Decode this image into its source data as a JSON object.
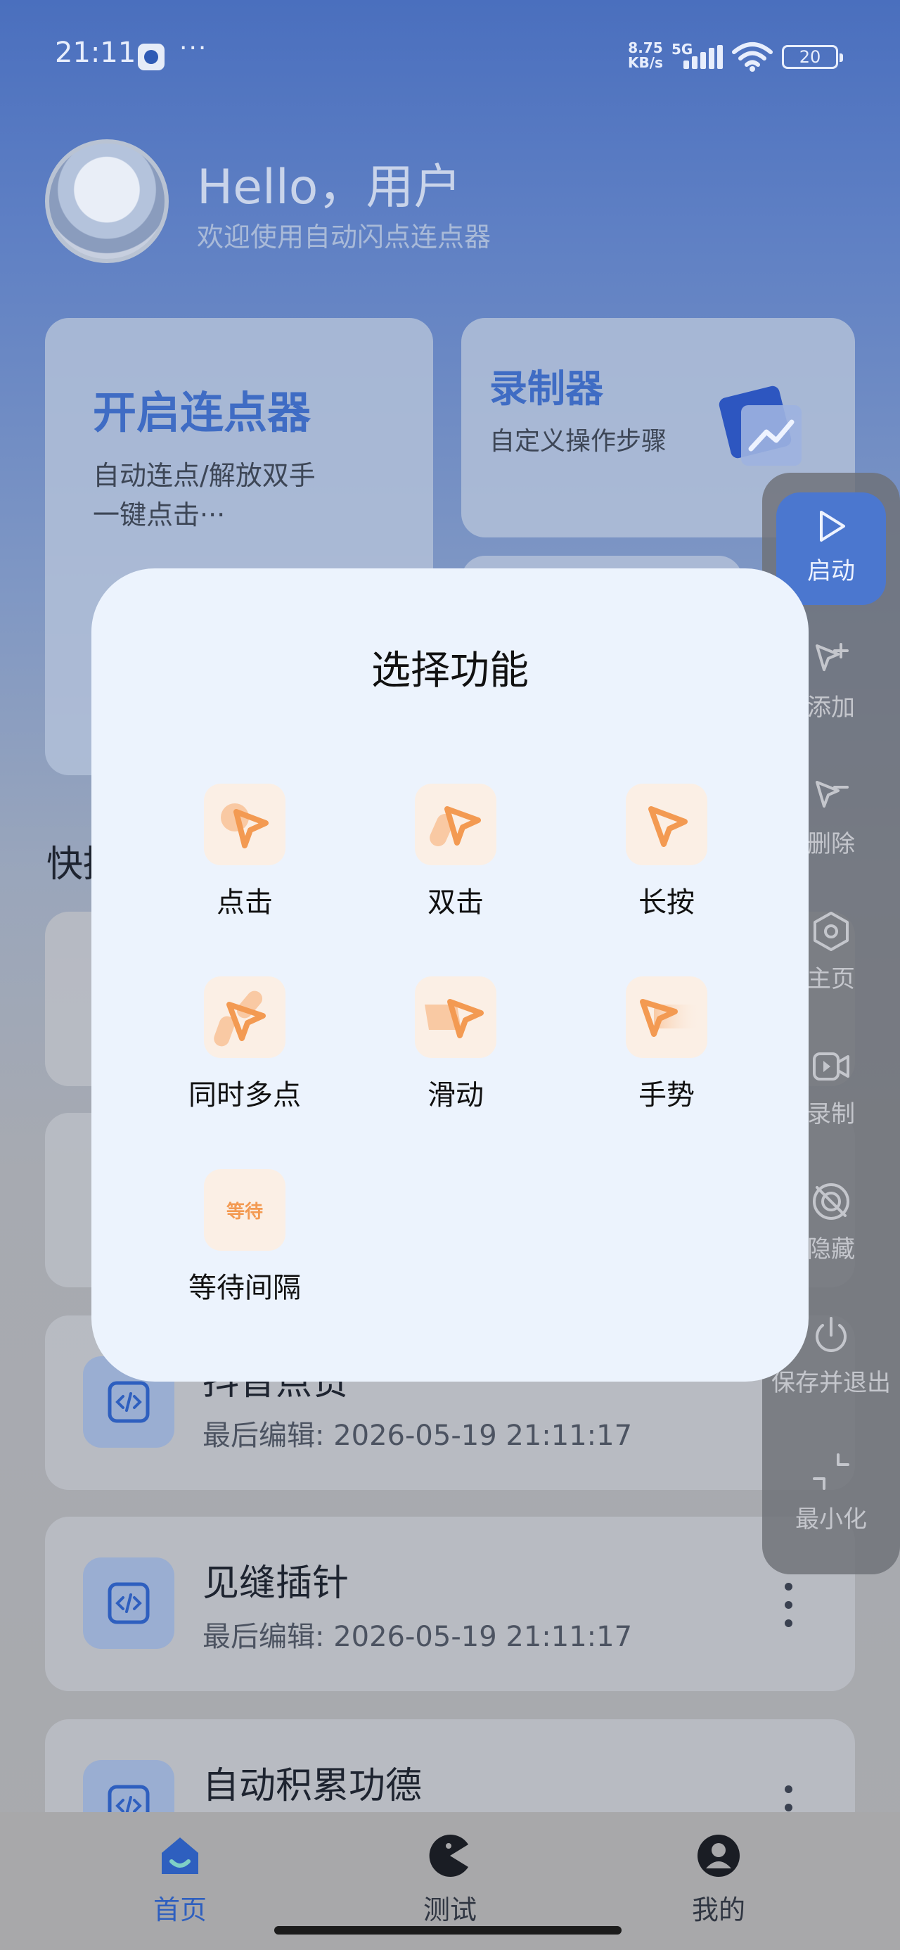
{
  "status_bar": {
    "time": "21:11",
    "more": "···",
    "net_speed_value": "8.75",
    "net_speed_unit": "KB/s",
    "network": "5G",
    "battery": "20"
  },
  "header": {
    "greeting": "Hello，用户",
    "subtitle": "欢迎使用自动闪点连点器"
  },
  "cards": {
    "start": {
      "title": "开启连点器",
      "desc": "自动连点/解放双手\n一键点击···"
    },
    "recorder": {
      "title": "录制器",
      "desc": "自定义操作步骤"
    }
  },
  "quick_section_title": "快捷",
  "scripts": [
    {
      "title": "抖音点赞",
      "subtitle": "最后编辑: 2026-05-19 21:11:17"
    },
    {
      "title": "见缝插针",
      "subtitle": "最后编辑: 2026-05-19 21:11:17"
    },
    {
      "title": "自动积累功德",
      "subtitle": ""
    }
  ],
  "bottom_nav": [
    {
      "label": "首页",
      "icon": "home-icon",
      "active": true
    },
    {
      "label": "测试",
      "icon": "pacman-icon",
      "active": false
    },
    {
      "label": "我的",
      "icon": "user-icon",
      "active": false
    }
  ],
  "floating_toolbar": {
    "start": "启动",
    "add": "添加",
    "delete": "删除",
    "home": "主页",
    "record": "录制",
    "hide": "隐藏",
    "save_exit": "保存并退出",
    "minimize": "最小化"
  },
  "dialog": {
    "title": "选择功能",
    "options": [
      {
        "label": "点击",
        "icon": "tap-icon"
      },
      {
        "label": "双击",
        "icon": "double-tap-icon"
      },
      {
        "label": "长按",
        "icon": "long-press-icon"
      },
      {
        "label": "同时多点",
        "icon": "multi-touch-icon"
      },
      {
        "label": "滑动",
        "icon": "swipe-icon"
      },
      {
        "label": "手势",
        "icon": "gesture-icon"
      },
      {
        "label": "等待间隔",
        "icon": "wait-icon",
        "icon_text": "等待"
      }
    ]
  },
  "colors": {
    "accent": "#4b77cf",
    "option_orange": "#f39a52",
    "dialog_bg": "#ecf3fd"
  }
}
